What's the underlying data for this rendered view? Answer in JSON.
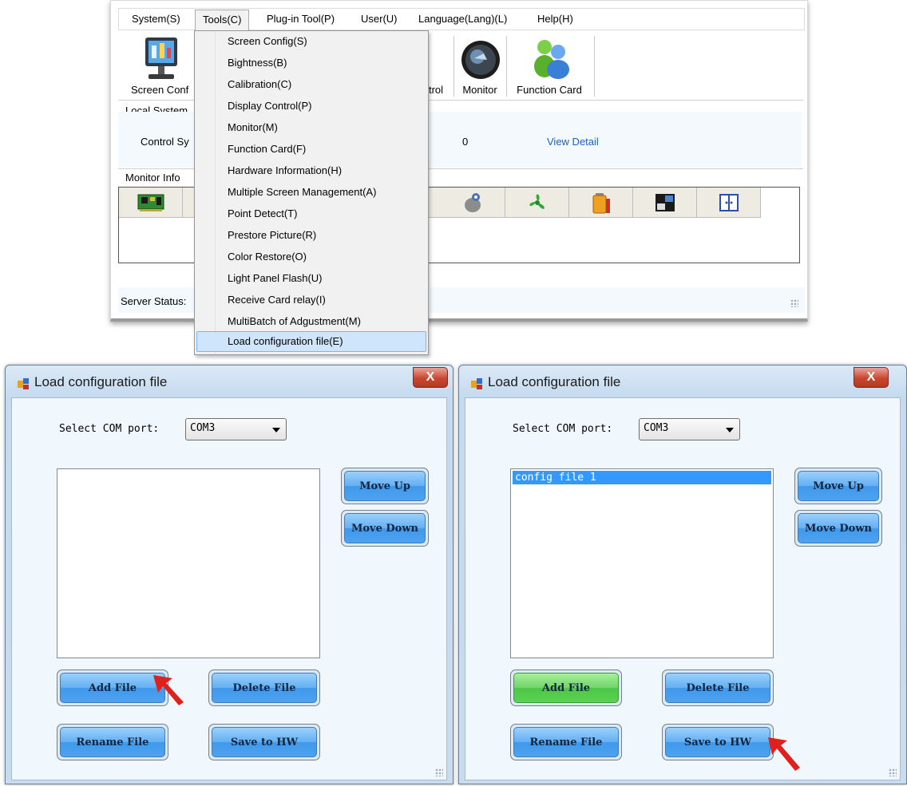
{
  "app": {
    "menu": [
      "System(S)",
      "Tools(C)",
      "Plug-in Tool(P)",
      "User(U)",
      "Language(Lang)(L)",
      "Help(H)"
    ],
    "toolbar": {
      "screen_config": "Screen Conf",
      "control": "trol",
      "monitor": "Monitor",
      "function_card": "Function Card"
    },
    "local_system_label": "Local System",
    "control_system_label": "Control Sy",
    "control_value": "0",
    "view_detail": "View Detail",
    "monitor_info_label": "Monitor Info",
    "server_status_label": "Server Status:",
    "tools_menu": [
      "Screen Config(S)",
      "Bightness(B)",
      "Calibration(C)",
      "Display Control(P)",
      "Monitor(M)",
      "Function Card(F)",
      "Hardware Information(H)",
      "Multiple Screen Management(A)",
      "Point Detect(T)",
      "Prestore Picture(R)",
      "Color Restore(O)",
      "Light Panel Flash(U)",
      "Receive Card relay(I)",
      "MultiBatch of Adgustment(M)",
      "Load configuration file(E)"
    ],
    "monitor_icons": [
      "circuit-board-icon",
      "blank",
      "blank",
      "blank",
      "blank",
      "hand-key-icon",
      "fan-icon",
      "battery-icon",
      "display-quadrant-icon",
      "door-icon"
    ]
  },
  "dialogs": [
    {
      "title": "Load configuration file",
      "close": "X",
      "com_label": "Select COM port:",
      "com_value": "COM3",
      "list_items": [],
      "buttons": {
        "move_up": "Move Up",
        "move_down": "Move Down",
        "add_file": "Add File",
        "delete_file": "Delete File",
        "rename_file": "Rename File",
        "save_to_hw": "Save to HW"
      },
      "arrow_points_to": "Add File"
    },
    {
      "title": "Load configuration file",
      "close": "X",
      "com_label": "Select COM port:",
      "com_value": "COM3",
      "list_items": [
        "config file 1"
      ],
      "buttons": {
        "move_up": "Move Up",
        "move_down": "Move Down",
        "add_file": "Add File",
        "delete_file": "Delete File",
        "rename_file": "Rename File",
        "save_to_hw": "Save to HW"
      },
      "arrow_points_to": "Save to HW"
    }
  ],
  "colors": {
    "highlight": "#cfe5fb",
    "link": "#1f5fbf",
    "button_blue": "#4ea3ef",
    "button_green": "#5ad252",
    "arrow_red": "#e0201a",
    "close_red": "#c9462f"
  }
}
